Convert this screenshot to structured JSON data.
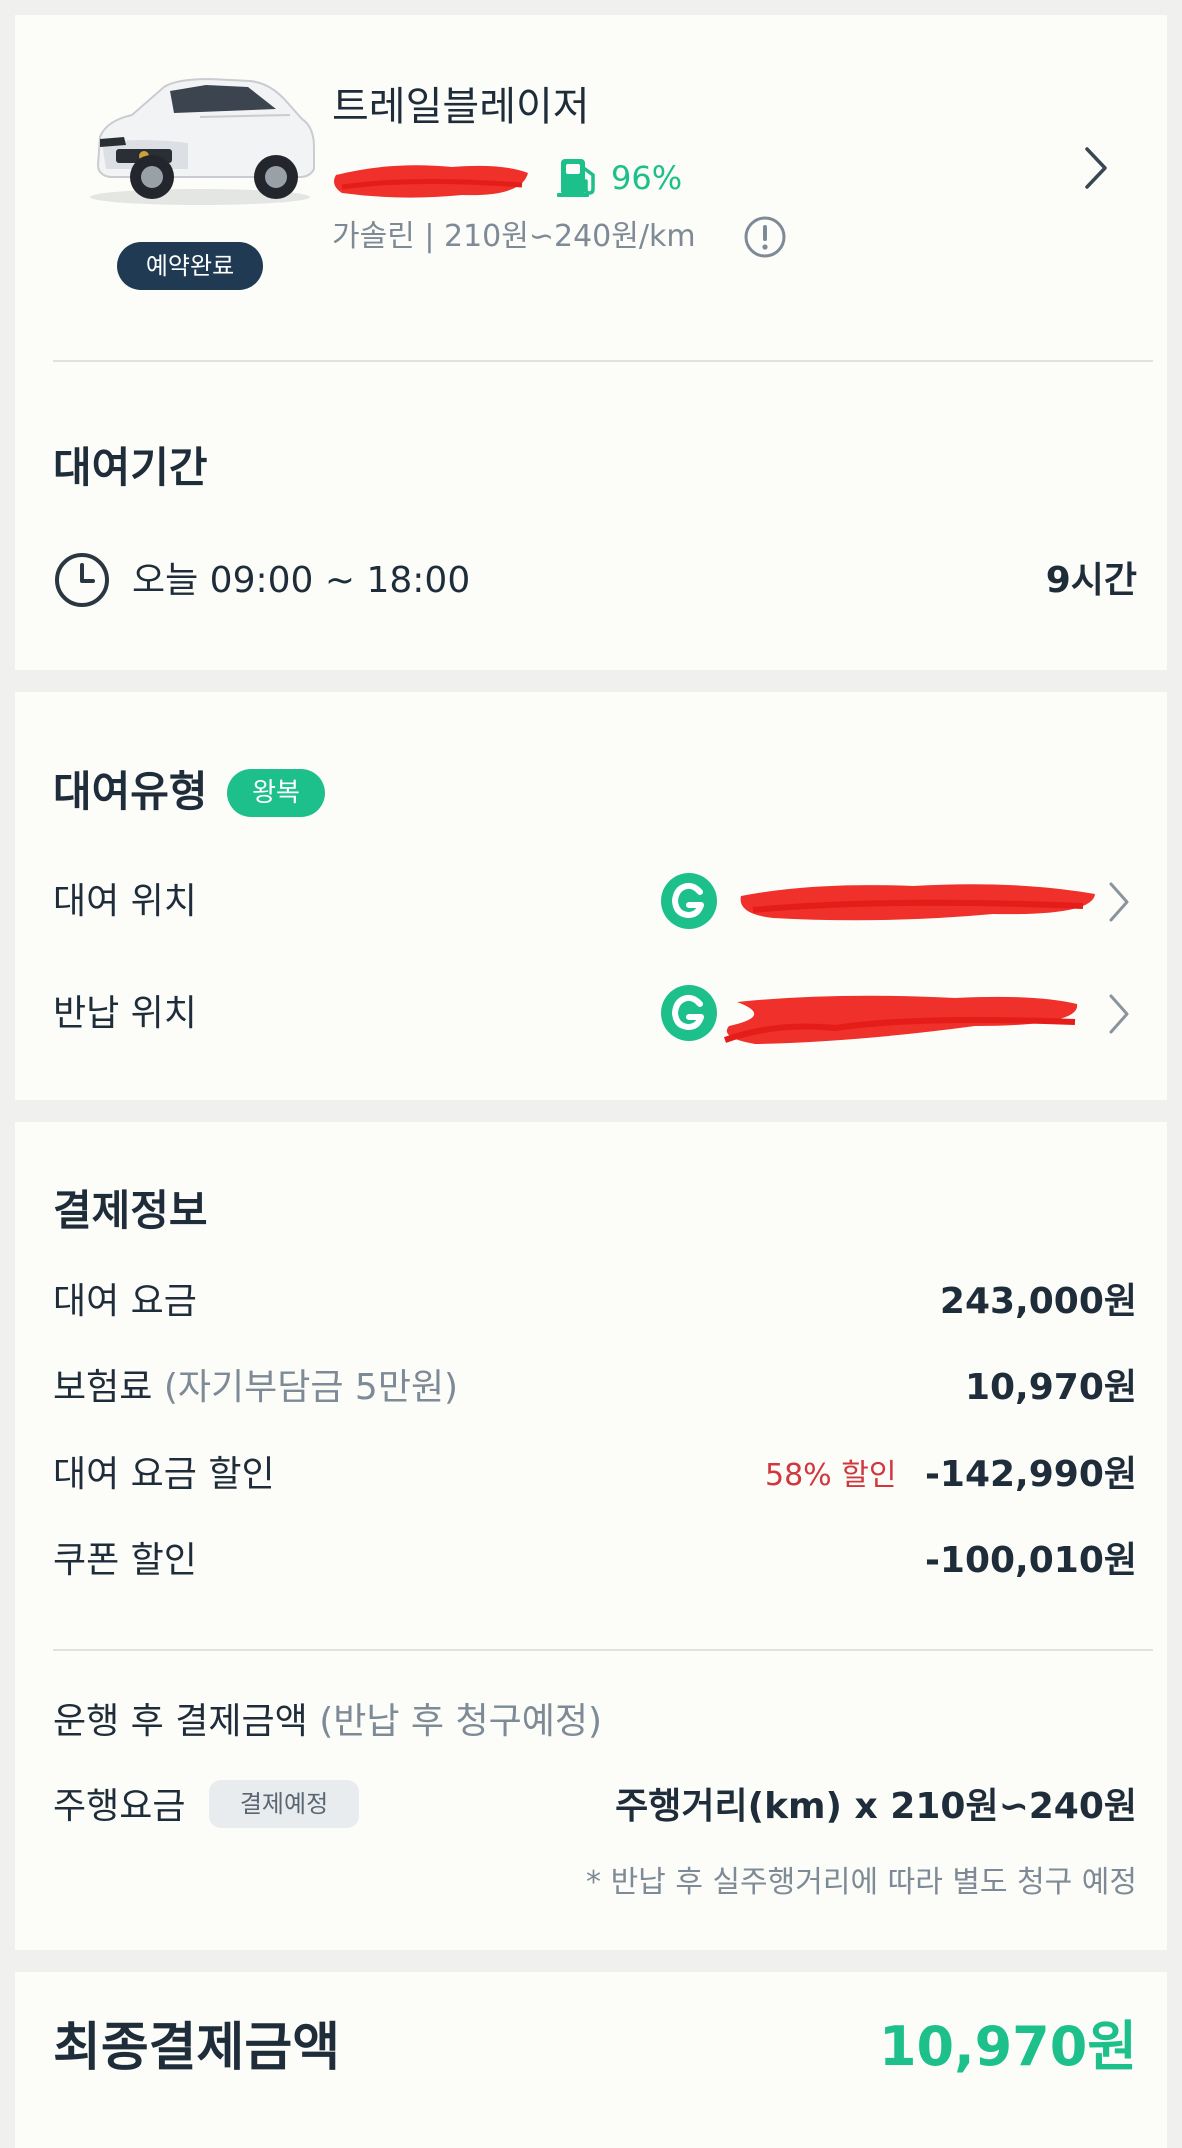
{
  "vehicle": {
    "name": "트레일블레이저",
    "fuel_level": "96%",
    "fuel_info": "가솔린 | 210원∽240원/km",
    "status_badge": "예약완료"
  },
  "rental_period": {
    "title": "대여기간",
    "time_range": "오늘 09:00 ~ 18:00",
    "duration": "9시간"
  },
  "rental_type": {
    "title": "대여유형",
    "badge": "왕복",
    "pickup_label": "대여 위치",
    "return_label": "반납 위치"
  },
  "payment": {
    "title": "결제정보",
    "rows": [
      {
        "label": "대여 요금",
        "value": "243,000원"
      },
      {
        "label": "보험료",
        "sublabel": "(자기부담금 5만원)",
        "value": "10,970원"
      },
      {
        "label": "대여 요금 할인",
        "tag": "58% 할인",
        "value": "-142,990원"
      },
      {
        "label": "쿠폰 할인",
        "value": "-100,010원"
      }
    ],
    "post_label": "운행 후 결제금액",
    "post_sublabel": "(반납 후 청구예정)",
    "mileage_label": "주행요금",
    "mileage_badge": "결제예정",
    "mileage_value": "주행거리(km) x 210원∽240원",
    "mileage_note": "* 반납 후 실주행거리에 따라 별도 청구 예정"
  },
  "final": {
    "label": "최종결제금액",
    "value": "10,970원"
  },
  "colors": {
    "accent_green": "#1dbf8a",
    "navy": "#1f3a52",
    "discount_red": "#d0383e",
    "gray_text": "#7e8a96"
  }
}
